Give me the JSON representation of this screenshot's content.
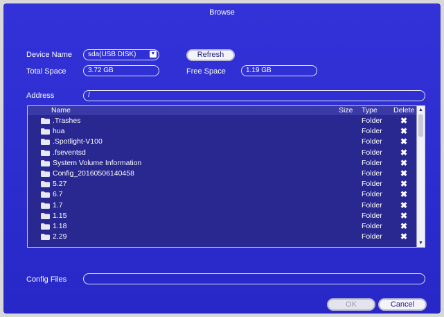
{
  "window": {
    "title": "Browse"
  },
  "device": {
    "name_label": "Device Name",
    "name_value": "sda(USB DISK)",
    "refresh_label": "Refresh",
    "total_label": "Total Space",
    "total_value": "3.72 GB",
    "free_label": "Free Space",
    "free_value": "1.19 GB"
  },
  "address": {
    "label": "Address",
    "value": "/"
  },
  "file_list": {
    "columns": {
      "name": "Name",
      "size": "Size",
      "type": "Type",
      "delete": "Delete"
    },
    "rows": [
      {
        "name": ".Trashes",
        "type": "Folder",
        "delete": "✖"
      },
      {
        "name": "hua",
        "type": "Folder",
        "delete": "✖"
      },
      {
        "name": ".Spotlight-V100",
        "type": "Folder",
        "delete": "✖"
      },
      {
        "name": ".fseventsd",
        "type": "Folder",
        "delete": "✖"
      },
      {
        "name": "System Volume Information",
        "type": "Folder",
        "delete": "✖"
      },
      {
        "name": "Config_20160506140458",
        "type": "Folder",
        "delete": "✖"
      },
      {
        "name": "5.27",
        "type": "Folder",
        "delete": "✖"
      },
      {
        "name": "6.7",
        "type": "Folder",
        "delete": "✖"
      },
      {
        "name": "1.7",
        "type": "Folder",
        "delete": "✖"
      },
      {
        "name": "1.15",
        "type": "Folder",
        "delete": "✖"
      },
      {
        "name": "1.18",
        "type": "Folder",
        "delete": "✖"
      },
      {
        "name": "2.29",
        "type": "Folder",
        "delete": "✖"
      }
    ]
  },
  "config_files": {
    "label": "Config Files",
    "value": ""
  },
  "footer": {
    "ok_label": "OK",
    "cancel_label": "Cancel"
  },
  "colors": {
    "background": "#2a2acc",
    "list_bg": "#282890",
    "text": "#ffffff"
  }
}
